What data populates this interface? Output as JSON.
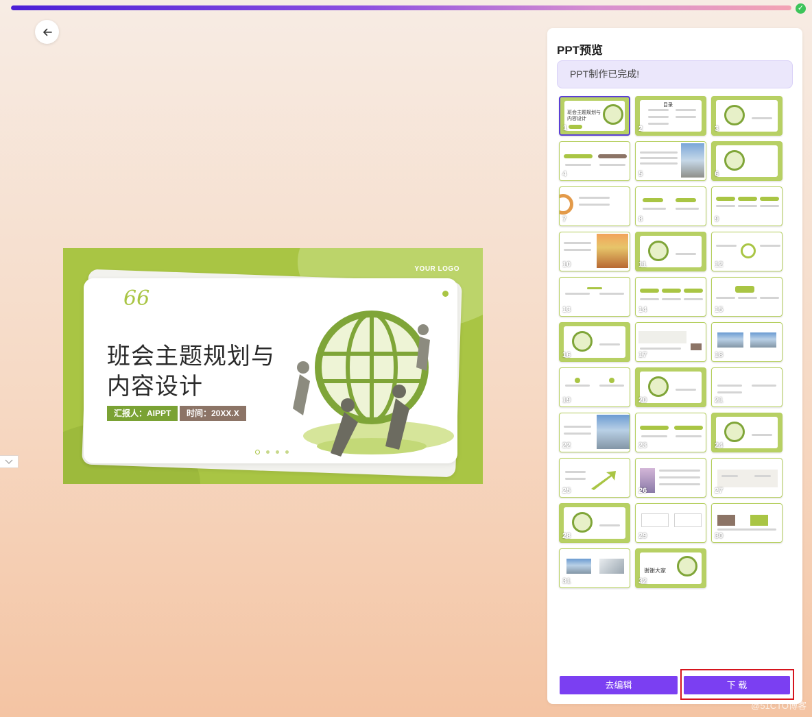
{
  "progress": {
    "value": 1.0
  },
  "nav": {
    "back_icon": "arrow-left-icon",
    "side_toggle_icon": "chevron-down-icon"
  },
  "slide": {
    "logo": "YOUR LOGO",
    "quote": "66",
    "title_line1": "班会主题规划与",
    "title_line2": "内容设计",
    "reporter": "汇报人：AIPPT",
    "time": "时间：20XX.X",
    "accent_color": "#a9c544"
  },
  "panel": {
    "title": "PPT预览",
    "status": "PPT制作已完成!",
    "thumb_title_1": "班会主题规划与内容设计",
    "thumb_title_2": "目录",
    "thumb_title_32": "谢谢大家",
    "thumbnails": [
      "1",
      "2",
      "3",
      "4",
      "5",
      "6",
      "7",
      "8",
      "9",
      "10",
      "11",
      "12",
      "13",
      "14",
      "15",
      "16",
      "17",
      "18",
      "19",
      "20",
      "21",
      "22",
      "23",
      "24",
      "25",
      "26",
      "27",
      "28",
      "29",
      "30",
      "31",
      "32"
    ],
    "edit_label": "去编辑",
    "download_label": "下 载",
    "brand_color": "#7b3ff2"
  },
  "watermark": "@51CTO博客"
}
